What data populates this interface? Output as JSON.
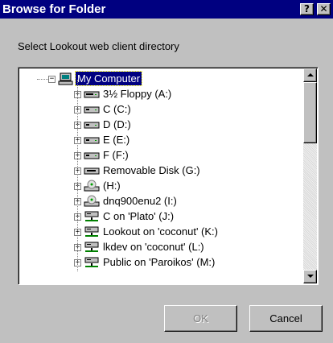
{
  "window": {
    "title": "Browse for Folder",
    "help_button": "?",
    "close_button": "✕"
  },
  "instruction": "Select Lookout web client directory",
  "tree": {
    "root": {
      "label": "My Computer",
      "icon": "computer-icon",
      "expander": "−",
      "selected": true
    },
    "items": [
      {
        "label": "3½ Floppy (A:)",
        "icon": "floppy-drive-icon",
        "expander": "+"
      },
      {
        "label": "C (C:)",
        "icon": "hard-drive-icon",
        "expander": "+"
      },
      {
        "label": "D (D:)",
        "icon": "hard-drive-icon",
        "expander": "+"
      },
      {
        "label": "E (E:)",
        "icon": "hard-drive-icon",
        "expander": "+"
      },
      {
        "label": "F (F:)",
        "icon": "hard-drive-icon",
        "expander": "+"
      },
      {
        "label": "Removable Disk (G:)",
        "icon": "removable-disk-icon",
        "expander": "+"
      },
      {
        "label": "(H:)",
        "icon": "cd-drive-icon",
        "expander": "+"
      },
      {
        "label": "dnq900enu2 (I:)",
        "icon": "cd-drive-icon",
        "expander": "+"
      },
      {
        "label": "C on 'Plato' (J:)",
        "icon": "network-drive-icon",
        "expander": "+"
      },
      {
        "label": "Lookout on 'coconut' (K:)",
        "icon": "network-drive-icon",
        "expander": "+"
      },
      {
        "label": "lkdev on 'coconut' (L:)",
        "icon": "network-drive-icon",
        "expander": "+"
      },
      {
        "label": "Public on 'Paroikos' (M:)",
        "icon": "network-drive-icon",
        "expander": "+"
      }
    ]
  },
  "buttons": {
    "ok": "OK",
    "ok_enabled": false,
    "cancel": "Cancel"
  },
  "colors": {
    "titlebar": "#000080",
    "dialog_face": "#c0c0c0",
    "selection": "#000080"
  }
}
